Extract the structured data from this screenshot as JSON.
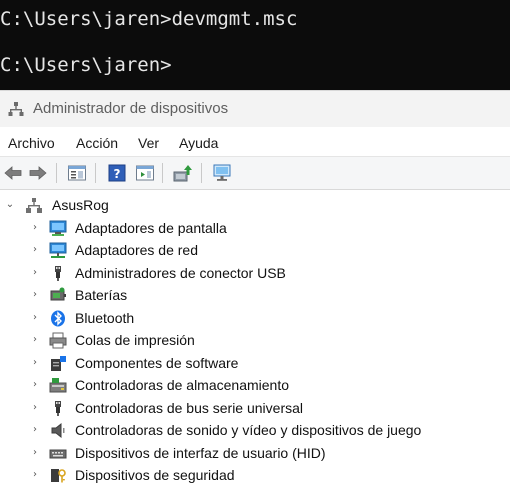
{
  "terminal": {
    "line1": "C:\\Users\\jaren>devmgmt.msc",
    "line2": "C:\\Users\\jaren>"
  },
  "window": {
    "title": "Administrador de dispositivos",
    "app_icon": "device-manager-icon"
  },
  "menu": {
    "items": [
      "Archivo",
      "Acción",
      "Ver",
      "Ayuda"
    ]
  },
  "toolbar": {
    "icons": [
      "back-arrow-icon",
      "forward-arrow-icon",
      "properties-icon",
      "help-icon",
      "view-pane-icon",
      "update-driver-icon",
      "scan-hardware-icon"
    ]
  },
  "tree": {
    "root": {
      "label": "AsusRog",
      "expanded": true,
      "icon": "computer-icon"
    },
    "categories": [
      {
        "label": "Adaptadores de pantalla",
        "icon": "display-adapter-icon"
      },
      {
        "label": "Adaptadores de red",
        "icon": "network-adapter-icon"
      },
      {
        "label": "Administradores de conector USB",
        "icon": "usb-connector-icon"
      },
      {
        "label": "Baterías",
        "icon": "battery-icon"
      },
      {
        "label": "Bluetooth",
        "icon": "bluetooth-icon"
      },
      {
        "label": "Colas de impresión",
        "icon": "printer-icon"
      },
      {
        "label": "Componentes de software",
        "icon": "software-component-icon"
      },
      {
        "label": "Controladoras de almacenamiento",
        "icon": "storage-controller-icon"
      },
      {
        "label": "Controladoras de bus serie universal",
        "icon": "usb-bus-icon"
      },
      {
        "label": "Controladoras de sonido y vídeo y dispositivos de juego",
        "icon": "sound-icon"
      },
      {
        "label": "Dispositivos de interfaz de usuario (HID)",
        "icon": "hid-icon"
      },
      {
        "label": "Dispositivos de seguridad",
        "icon": "security-device-icon"
      }
    ]
  }
}
